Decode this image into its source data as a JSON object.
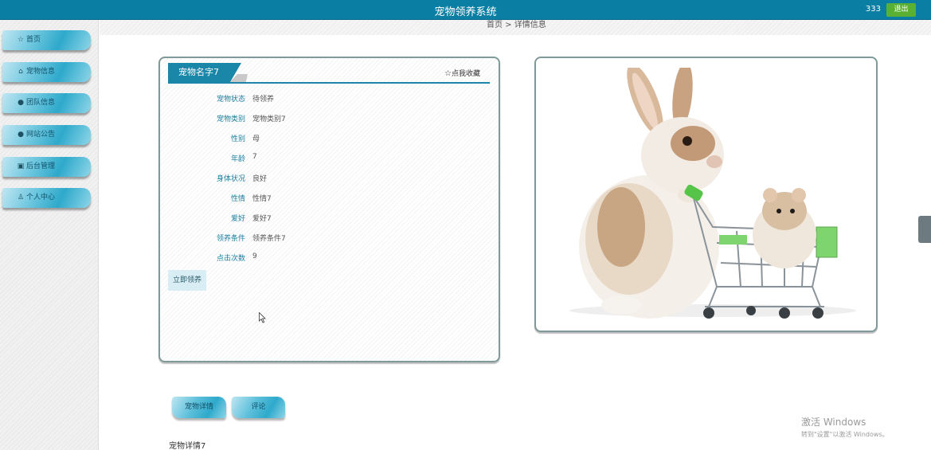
{
  "header": {
    "title": "宠物领养系统",
    "username": "333",
    "logout_label": "退出"
  },
  "sidebar": {
    "items": [
      {
        "label": "首页",
        "icon": "star-icon"
      },
      {
        "label": "宠物信息",
        "icon": "home-icon"
      },
      {
        "label": "团队信息",
        "icon": "info-circle-icon"
      },
      {
        "label": "网站公告",
        "icon": "question-circle-icon"
      },
      {
        "label": "后台管理",
        "icon": "gift-icon"
      },
      {
        "label": "个人中心",
        "icon": "user-icon"
      }
    ]
  },
  "breadcrumb": "首页 > 详情信息",
  "pet": {
    "name": "宠物名字7",
    "favorite_label": "点我收藏",
    "fields": [
      {
        "label": "宠物状态",
        "value": "待领养"
      },
      {
        "label": "宠物类别",
        "value": "宠物类别7"
      },
      {
        "label": "性别",
        "value": "母"
      },
      {
        "label": "年龄",
        "value": "7"
      },
      {
        "label": "身体状况",
        "value": "良好"
      },
      {
        "label": "性情",
        "value": "性情7"
      },
      {
        "label": "爱好",
        "value": "爱好7"
      },
      {
        "label": "领养条件",
        "value": "领养条件7"
      },
      {
        "label": "点击次数",
        "value": "9"
      }
    ],
    "adopt_label": "立即领养"
  },
  "tabs": {
    "detail_label": "宠物详情",
    "comment_label": "评论"
  },
  "detail_text": "宠物详情7",
  "watermark": {
    "line1": "激活 Windows",
    "line2": "转到\"设置\"以激活 Windows。"
  }
}
